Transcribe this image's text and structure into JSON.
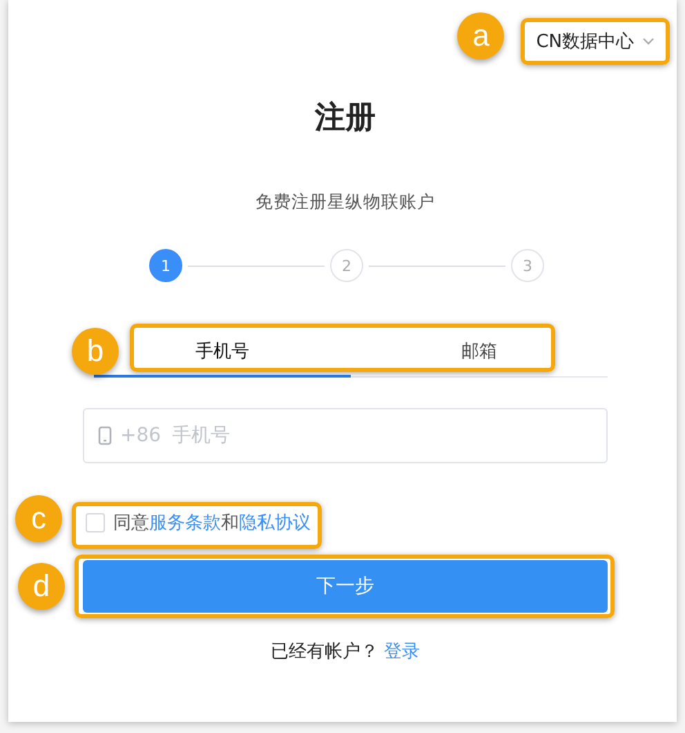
{
  "region_selector": {
    "value": "CN数据中心",
    "callout": "a"
  },
  "title": "注册",
  "subtitle": "免费注册星纵物联账户",
  "steps": [
    {
      "label": "1",
      "selected": true
    },
    {
      "label": "2",
      "selected": false
    },
    {
      "label": "3",
      "selected": false
    }
  ],
  "tabs": {
    "callout": "b",
    "items": [
      {
        "label": "手机号",
        "selected": true
      },
      {
        "label": "邮箱",
        "selected": false
      }
    ]
  },
  "phone_field": {
    "prefix": "+86",
    "placeholder": "手机号"
  },
  "agreement": {
    "callout": "c",
    "checked": false,
    "parts": [
      {
        "kind": "text",
        "text": "同意"
      },
      {
        "kind": "link",
        "text": "服务条款"
      },
      {
        "kind": "text",
        "text": "和"
      },
      {
        "kind": "link",
        "text": "隐私协议"
      }
    ]
  },
  "next_button": {
    "label": "下一步",
    "callout": "d"
  },
  "login_prompt": {
    "text": "已经有帐户？",
    "link": "登录"
  }
}
